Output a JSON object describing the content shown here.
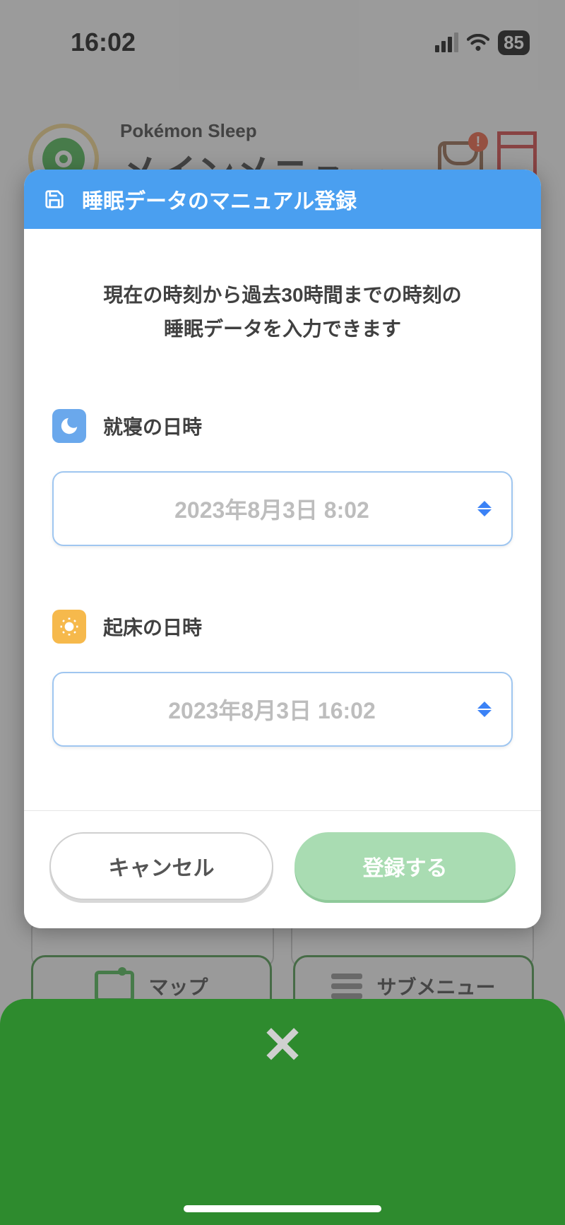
{
  "status": {
    "time": "16:02",
    "battery": "85"
  },
  "background": {
    "app_name": "Pokémon Sleep",
    "app_title": "メインメニュー",
    "map_label": "マップ",
    "submenu_label": "サブメニュー"
  },
  "modal": {
    "title": "睡眠データのマニュアル登録",
    "info_line1": "現在の時刻から過去30時間までの時刻の",
    "info_line2": "睡眠データを入力できます",
    "bedtime_label": "就寝の日時",
    "bedtime_value": "2023年8月3日  8:02",
    "wakeup_label": "起床の日時",
    "wakeup_value": "2023年8月3日  16:02",
    "cancel_label": "キャンセル",
    "submit_label": "登録する"
  }
}
